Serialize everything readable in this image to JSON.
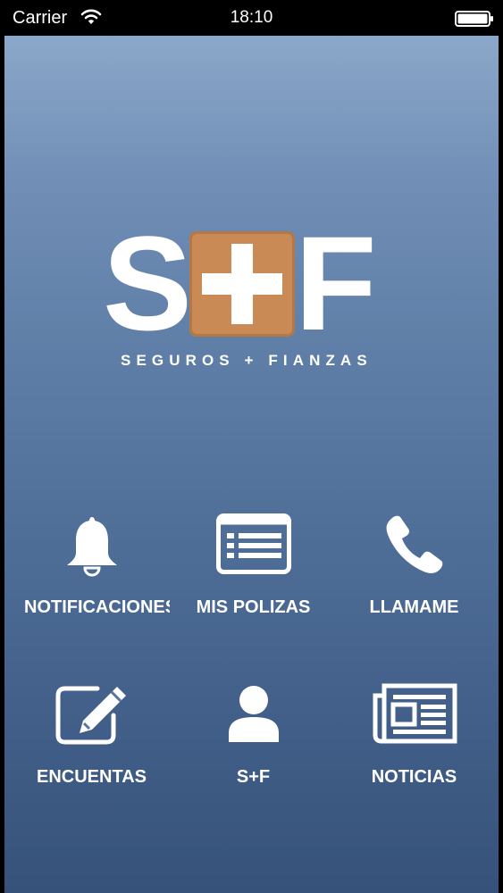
{
  "status_bar": {
    "carrier": "Carrier",
    "time": "18:10"
  },
  "logo": {
    "letter_left": "S",
    "letter_right": "F",
    "tagline": "SEGUROS + FIANZAS",
    "accent_color": "#c98a55"
  },
  "menu": {
    "items": [
      {
        "label": "NOTIFICACIONES",
        "icon": "bell-icon"
      },
      {
        "label": "MIS POLIZAS",
        "icon": "list-card-icon"
      },
      {
        "label": "LLAMAME",
        "icon": "phone-icon"
      },
      {
        "label": "ENCUENTAS",
        "icon": "edit-icon"
      },
      {
        "label": "S+F",
        "icon": "user-icon"
      },
      {
        "label": "NOTICIAS",
        "icon": "newspaper-icon"
      }
    ]
  }
}
